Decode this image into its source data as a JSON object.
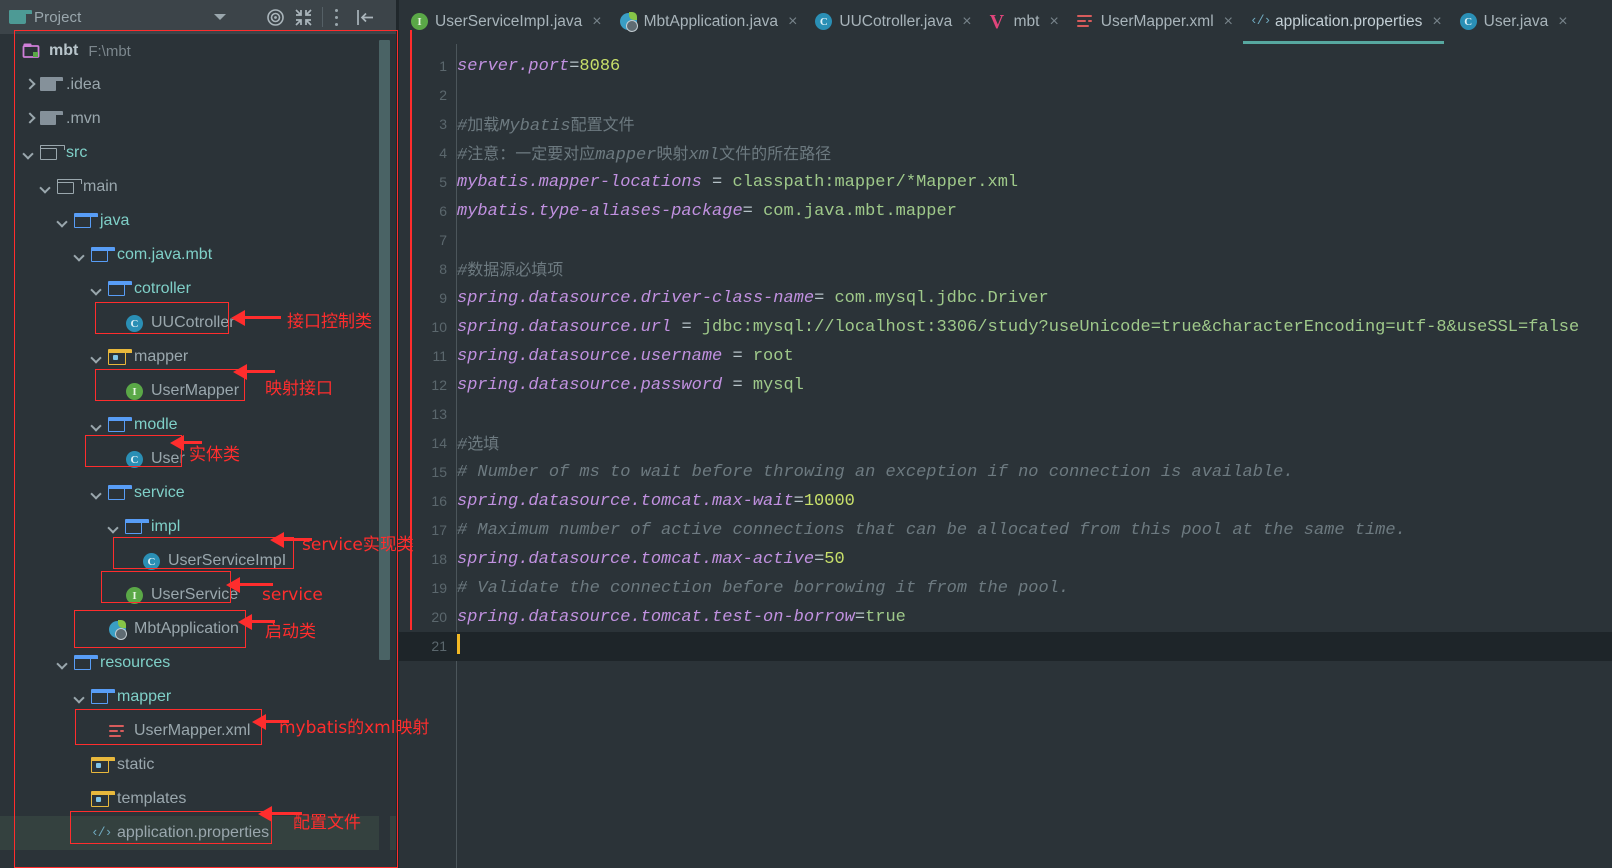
{
  "window": {
    "project_tool_title": "Project",
    "icons": {
      "project_folder": "folder-icon",
      "dropdown": "chevron-down-icon",
      "locate": "locate-target-icon",
      "collapse_all": "collapse-all-icon",
      "options": "more-options-icon",
      "hide": "hide-panel-icon"
    }
  },
  "tree": {
    "root": {
      "label": "mbt",
      "path": "F:\\mbt",
      "icon": "module-folder-icon",
      "expanded": true
    },
    "items": [
      {
        "label": ".idea",
        "indent": 1,
        "icon": "folder-gray-icon",
        "state": "collapsed",
        "style": "plain"
      },
      {
        "label": ".mvn",
        "indent": 1,
        "icon": "folder-gray-icon",
        "state": "collapsed",
        "style": "plain"
      },
      {
        "label": "src",
        "indent": 1,
        "icon": "folder-outline-icon",
        "state": "expanded",
        "style": "src"
      },
      {
        "label": "main",
        "indent": 2,
        "icon": "folder-outline-icon",
        "state": "expanded",
        "style": "plain"
      },
      {
        "label": "java",
        "indent": 3,
        "icon": "folder-source-icon",
        "state": "expanded",
        "style": "src"
      },
      {
        "label": "com.java.mbt",
        "indent": 4,
        "icon": "folder-source-icon",
        "state": "expanded",
        "style": "src"
      },
      {
        "label": "cotroller",
        "indent": 5,
        "icon": "folder-source-icon",
        "state": "expanded",
        "style": "src"
      },
      {
        "label": "UUCotroller",
        "indent": 6,
        "icon": "java-class-icon",
        "state": "leaf",
        "style": "plain"
      },
      {
        "label": "mapper",
        "indent": 5,
        "icon": "folder-yellow-icon",
        "state": "expanded",
        "style": "plain"
      },
      {
        "label": "UserMapper",
        "indent": 6,
        "icon": "java-interface-icon",
        "state": "leaf",
        "style": "plain"
      },
      {
        "label": "modle",
        "indent": 5,
        "icon": "folder-source-icon",
        "state": "expanded",
        "style": "src"
      },
      {
        "label": "User",
        "indent": 6,
        "icon": "java-class-icon",
        "state": "leaf",
        "style": "plain"
      },
      {
        "label": "service",
        "indent": 5,
        "icon": "folder-source-icon",
        "state": "expanded",
        "style": "src"
      },
      {
        "label": "impl",
        "indent": 6,
        "icon": "folder-source-icon",
        "state": "expanded",
        "style": "src"
      },
      {
        "label": "UserServiceImpI",
        "indent": 7,
        "icon": "java-class-icon",
        "state": "leaf",
        "style": "plain"
      },
      {
        "label": "UserService",
        "indent": 6,
        "icon": "java-interface-icon",
        "state": "leaf",
        "style": "plain"
      },
      {
        "label": "MbtApplication",
        "indent": 5,
        "icon": "spring-boot-icon",
        "state": "leaf",
        "style": "plain"
      },
      {
        "label": "resources",
        "indent": 3,
        "icon": "folder-source-icon",
        "state": "expanded",
        "style": "src"
      },
      {
        "label": "mapper",
        "indent": 4,
        "icon": "folder-source-icon",
        "state": "expanded",
        "style": "src"
      },
      {
        "label": "UserMapper.xml",
        "indent": 5,
        "icon": "xml-file-icon",
        "state": "leaf",
        "style": "plain"
      },
      {
        "label": "static",
        "indent": 4,
        "icon": "folder-yellow-icon",
        "state": "leaf",
        "style": "plain"
      },
      {
        "label": "templates",
        "indent": 4,
        "icon": "folder-yellow-icon",
        "state": "leaf",
        "style": "plain"
      },
      {
        "label": "application.properties",
        "indent": 4,
        "icon": "properties-file-icon",
        "state": "leaf",
        "style": "plain",
        "selected": true
      }
    ]
  },
  "tabs": [
    {
      "label": "UserServiceImpI.java",
      "icon": "java-interface-icon",
      "active": false
    },
    {
      "label": "MbtApplication.java",
      "icon": "spring-boot-icon",
      "active": false
    },
    {
      "label": "UUCotroller.java",
      "icon": "java-class-icon",
      "active": false
    },
    {
      "label": "mbt",
      "icon": "maven-v-icon",
      "active": false
    },
    {
      "label": "UserMapper.xml",
      "icon": "xml-file-icon",
      "active": false
    },
    {
      "label": "application.properties",
      "icon": "properties-file-icon",
      "active": true
    },
    {
      "label": "User.java",
      "icon": "java-class-icon",
      "active": false
    }
  ],
  "tab_close_glyph": "×",
  "editor": {
    "line_numbers": [
      "1",
      "2",
      "3",
      "4",
      "5",
      "6",
      "7",
      "8",
      "9",
      "10",
      "11",
      "12",
      "13",
      "14",
      "15",
      "16",
      "17",
      "18",
      "19",
      "20",
      "21"
    ],
    "lines": [
      {
        "n": 1,
        "type": "prop",
        "key": "server.port",
        "sep": "=",
        "value": "8086",
        "value_kind": "num"
      },
      {
        "n": 2,
        "type": "blank"
      },
      {
        "n": 3,
        "type": "comment",
        "text": "#加载Mybatis配置文件"
      },
      {
        "n": 4,
        "type": "comment",
        "text": "#注意：一定要对应mapper映射xml文件的所在路径"
      },
      {
        "n": 5,
        "type": "prop",
        "key": "mybatis.mapper-locations",
        "sep": " = ",
        "value": "classpath:mapper/*Mapper.xml",
        "value_kind": "str"
      },
      {
        "n": 6,
        "type": "prop",
        "key": "mybatis.type-aliases-package",
        "sep": "= ",
        "value": "com.java.mbt.mapper",
        "value_kind": "str"
      },
      {
        "n": 7,
        "type": "blank"
      },
      {
        "n": 8,
        "type": "comment",
        "text": "#数据源必填项"
      },
      {
        "n": 9,
        "type": "prop",
        "key": "spring.datasource.driver-class-name",
        "sep": "= ",
        "value": "com.mysql.jdbc.Driver",
        "value_kind": "str"
      },
      {
        "n": 10,
        "type": "prop",
        "key": "spring.datasource.url",
        "sep": " = ",
        "value": "jdbc:mysql://localhost:3306/study?useUnicode=true&characterEncoding=utf-8&useSSL=false",
        "value_kind": "str"
      },
      {
        "n": 11,
        "type": "prop",
        "key": "spring.datasource.username",
        "sep": " = ",
        "value": "root",
        "value_kind": "str"
      },
      {
        "n": 12,
        "type": "prop",
        "key": "spring.datasource.password",
        "sep": " = ",
        "value": "mysql",
        "value_kind": "str"
      },
      {
        "n": 13,
        "type": "blank"
      },
      {
        "n": 14,
        "type": "comment",
        "text": "#选填"
      },
      {
        "n": 15,
        "type": "comment",
        "text": "# Number of ms to wait before throwing an exception if no connection is available."
      },
      {
        "n": 16,
        "type": "prop",
        "key": "spring.datasource.tomcat.max-wait",
        "sep": "=",
        "value": "10000",
        "value_kind": "num"
      },
      {
        "n": 17,
        "type": "comment",
        "text": "# Maximum number of active connections that can be allocated from this pool at the same time."
      },
      {
        "n": 18,
        "type": "prop",
        "key": "spring.datasource.tomcat.max-active",
        "sep": "=",
        "value": "50",
        "value_kind": "num"
      },
      {
        "n": 19,
        "type": "comment",
        "text": "# Validate the connection before borrowing it from the pool."
      },
      {
        "n": 20,
        "type": "prop",
        "key": "spring.datasource.tomcat.test-on-borrow",
        "sep": "=",
        "value": "true",
        "value_kind": "str"
      },
      {
        "n": 21,
        "type": "caret"
      }
    ]
  },
  "annotations": [
    {
      "id": "a1",
      "text": "接口控制类"
    },
    {
      "id": "a2",
      "text": "映射接口"
    },
    {
      "id": "a3",
      "text": "实体类"
    },
    {
      "id": "a4",
      "text": "service实现类"
    },
    {
      "id": "a5",
      "text": "service"
    },
    {
      "id": "a6",
      "text": "启动类"
    },
    {
      "id": "a7",
      "text": "mybatis的xml映射"
    },
    {
      "id": "a8",
      "text": "配置文件"
    }
  ],
  "colors": {
    "editor_bg": "#2b3338",
    "panel_header_bg": "#3c4449",
    "current_line_bg": "#1e2529",
    "selection_bg": "#34413f",
    "accent_tab_underline": "#57a8a0",
    "annotation_red": "#ff2d2d",
    "key_purple": "#c191e0",
    "value_green": "#9fc98a",
    "number_green": "#c8e06a",
    "comment_gray": "#6d7a80",
    "caret_yellow": "#f2b824"
  }
}
